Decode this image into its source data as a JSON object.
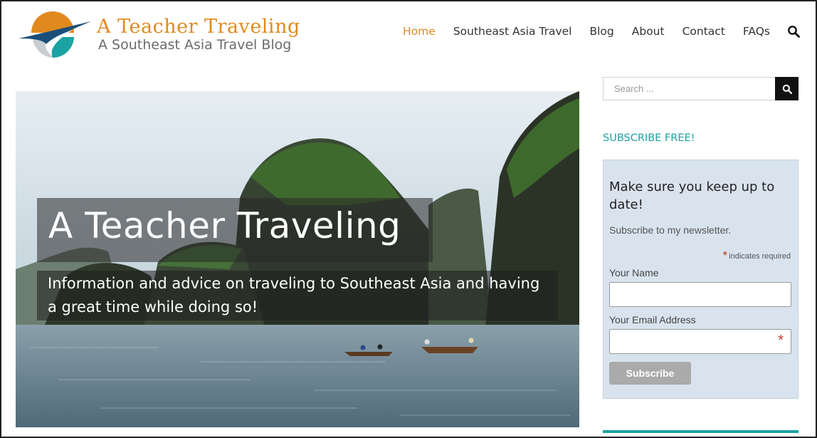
{
  "brand": {
    "title": "A Teacher Traveling",
    "subtitle": "A Southeast Asia Travel Blog",
    "icon": "globe-plane-logo",
    "colors": {
      "orange": "#e08a1e",
      "teal": "#1aa3a3",
      "gray": "#6b6b6b"
    }
  },
  "nav": {
    "items": [
      {
        "label": "Home",
        "active": true
      },
      {
        "label": "Southeast Asia Travel",
        "active": false
      },
      {
        "label": "Blog",
        "active": false
      },
      {
        "label": "About",
        "active": false
      },
      {
        "label": "Contact",
        "active": false
      },
      {
        "label": "FAQs",
        "active": false
      }
    ],
    "search_icon": "search-icon"
  },
  "hero": {
    "title": "A Teacher Traveling",
    "subtitle": "Information and advice on traveling to Southeast Asia and having a great time while doing so!"
  },
  "sidebar": {
    "search": {
      "placeholder": "Search ...",
      "button_icon": "search-icon"
    },
    "subscribe_heading": "SUBSCRIBE FREE!",
    "newsletter": {
      "title": "Make sure you keep up to date!",
      "text": "Subscribe to my newsletter.",
      "required_note": "indicates required",
      "required_marker": "*",
      "name_label": "Your Name",
      "email_label": "Your Email Address",
      "button": "Subscribe"
    }
  }
}
